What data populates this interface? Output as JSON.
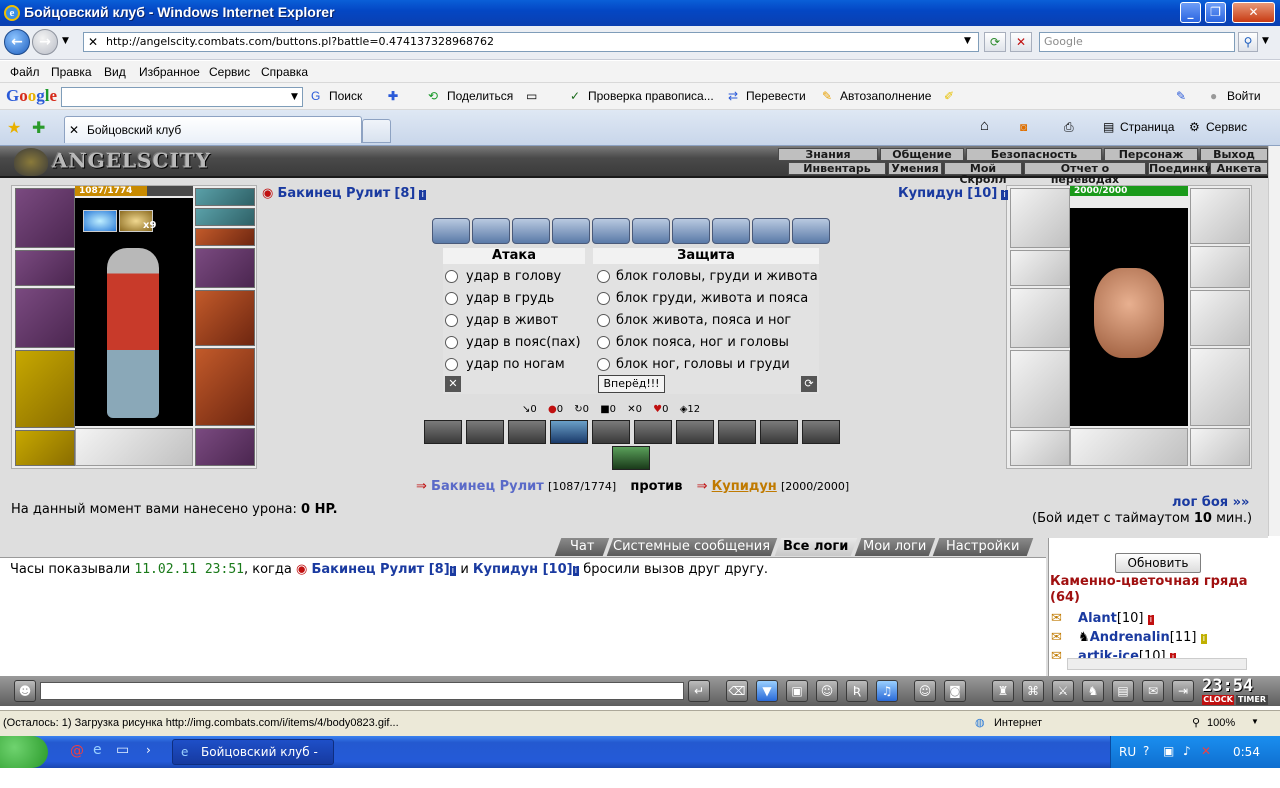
{
  "window": {
    "title": "Бойцовский клуб - Windows Internet Explorer"
  },
  "address": {
    "url": "http://angelscity.combats.com/buttons.pl?battle=0.474137328968762",
    "search_placeholder": "Google"
  },
  "menu": [
    "Файл",
    "Правка",
    "Вид",
    "Избранное",
    "Сервис",
    "Справка"
  ],
  "google_bar": {
    "logo": "Google",
    "search_label": "Поиск",
    "share": "Поделиться",
    "spell": "Проверка правописа...",
    "translate": "Перевести",
    "autofill": "Автозаполнение",
    "signin": "Войти"
  },
  "tab": {
    "title": "Бойцовский клуб",
    "page": "Страница",
    "service": "Сервис"
  },
  "game": {
    "logo": "ANGELSCITY",
    "top_menu": [
      "Знания",
      "Общение",
      "Безопасность",
      "Персонаж",
      "Выход"
    ],
    "sub_menu": [
      "Инвентарь",
      "Умения",
      "Мой Скролл",
      "Отчет о переводах",
      "Поединки",
      "Анкета"
    ],
    "player": {
      "name": "Бакинец Рулит",
      "level": "[8]",
      "hp": "1087/1774",
      "hp_full": "[1087/1774]",
      "hp_fraction": 0.613,
      "buff_count": "x9"
    },
    "enemy": {
      "name": "Купидун",
      "level": "[10]",
      "hp": "2000/2000",
      "hp_full": "[2000/2000]",
      "hp_fraction": 1.0
    },
    "attack_header": "Атака",
    "defense_header": "Защита",
    "attack": [
      "удар в голову",
      "удар в грудь",
      "удар в живот",
      "удар в пояс(пах)",
      "удар по ногам"
    ],
    "defense": [
      "блок головы, груди и живота",
      "блок груди, живота и пояса",
      "блок живота, пояса и ног",
      "блок пояса, ног и головы",
      "блок ног, головы и груди"
    ],
    "forward_button": "Вперёд!!!",
    "stats": [
      "0",
      "0",
      "0",
      "0",
      "0",
      "0",
      "12"
    ],
    "versus": "против",
    "damage_text": "На данный момент вами нанесено урона:",
    "damage_value": "0 HP.",
    "log_link": "лог боя »»",
    "timeout_pre": "(Бой идет с таймаутом",
    "timeout_value": "10",
    "timeout_post": "мин.)"
  },
  "chat": {
    "tabs": [
      "Чат",
      "Системные сообщения",
      "Все логи",
      "Мои логи",
      "Настройки"
    ],
    "msg_pre": "Часы показывали",
    "msg_time": "11.02.11 23:51",
    "msg_when": ", когда",
    "msg_p1": "Бакинец Рулит [8]",
    "msg_and": "и",
    "msg_p2": "Купидун [10]",
    "msg_post": "бросили вызов друг другу."
  },
  "side": {
    "refresh": "Обновить",
    "location": "Каменно-цветочная гряда (64)",
    "users": [
      {
        "name": "Alant",
        "level": "[10]"
      },
      {
        "name": "Andrenalin",
        "level": "[11]"
      },
      {
        "name": "artik-ice",
        "level": "[10]"
      }
    ]
  },
  "clock": {
    "time": "23:54",
    "clock_label": "CLOCK",
    "timer_label": "TIMER"
  },
  "status": {
    "text": "(Осталось: 1) Загрузка рисунка http://img.combats.com/i/items/4/body0823.gif...",
    "zone": "Интернет",
    "zoom": "100%"
  },
  "taskbar": {
    "task": "Бойцовский клуб - ...",
    "lang": "RU",
    "time": "0:54"
  }
}
